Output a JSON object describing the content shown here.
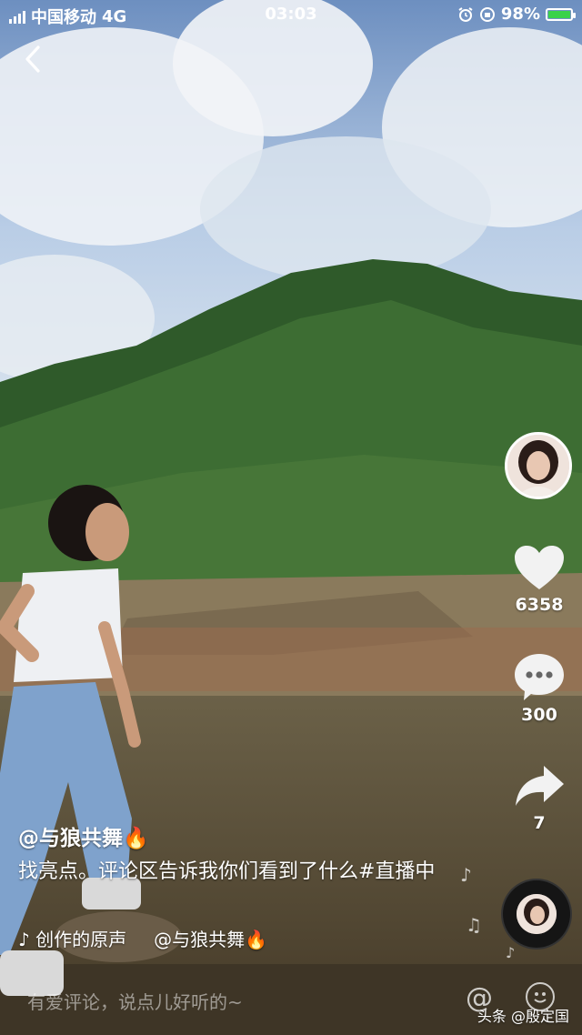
{
  "status_bar": {
    "carrier": "中国移动",
    "network": "4G",
    "time": "03:03",
    "battery": "98%",
    "battery_level": 0.98,
    "battery_color": "#3ad24a"
  },
  "icons": {
    "back": "back-icon",
    "like": "heart-icon",
    "comment": "comment-icon",
    "share": "share-icon",
    "music": "music-note-icon",
    "mention": "at-icon",
    "emoji": "emoji-icon"
  },
  "actions": {
    "likes": "6358",
    "comments": "300",
    "shares": "7"
  },
  "post": {
    "username": "@与狼共舞🔥",
    "description": "找亮点。评论区告诉我你们看到了什么#直播中",
    "music_title": "创作的原声",
    "music_author": "@与狼共舞🔥"
  },
  "comment_input": {
    "placeholder": "有爱评论，说点儿好听的~"
  },
  "watermark": "头条 @殷定国"
}
